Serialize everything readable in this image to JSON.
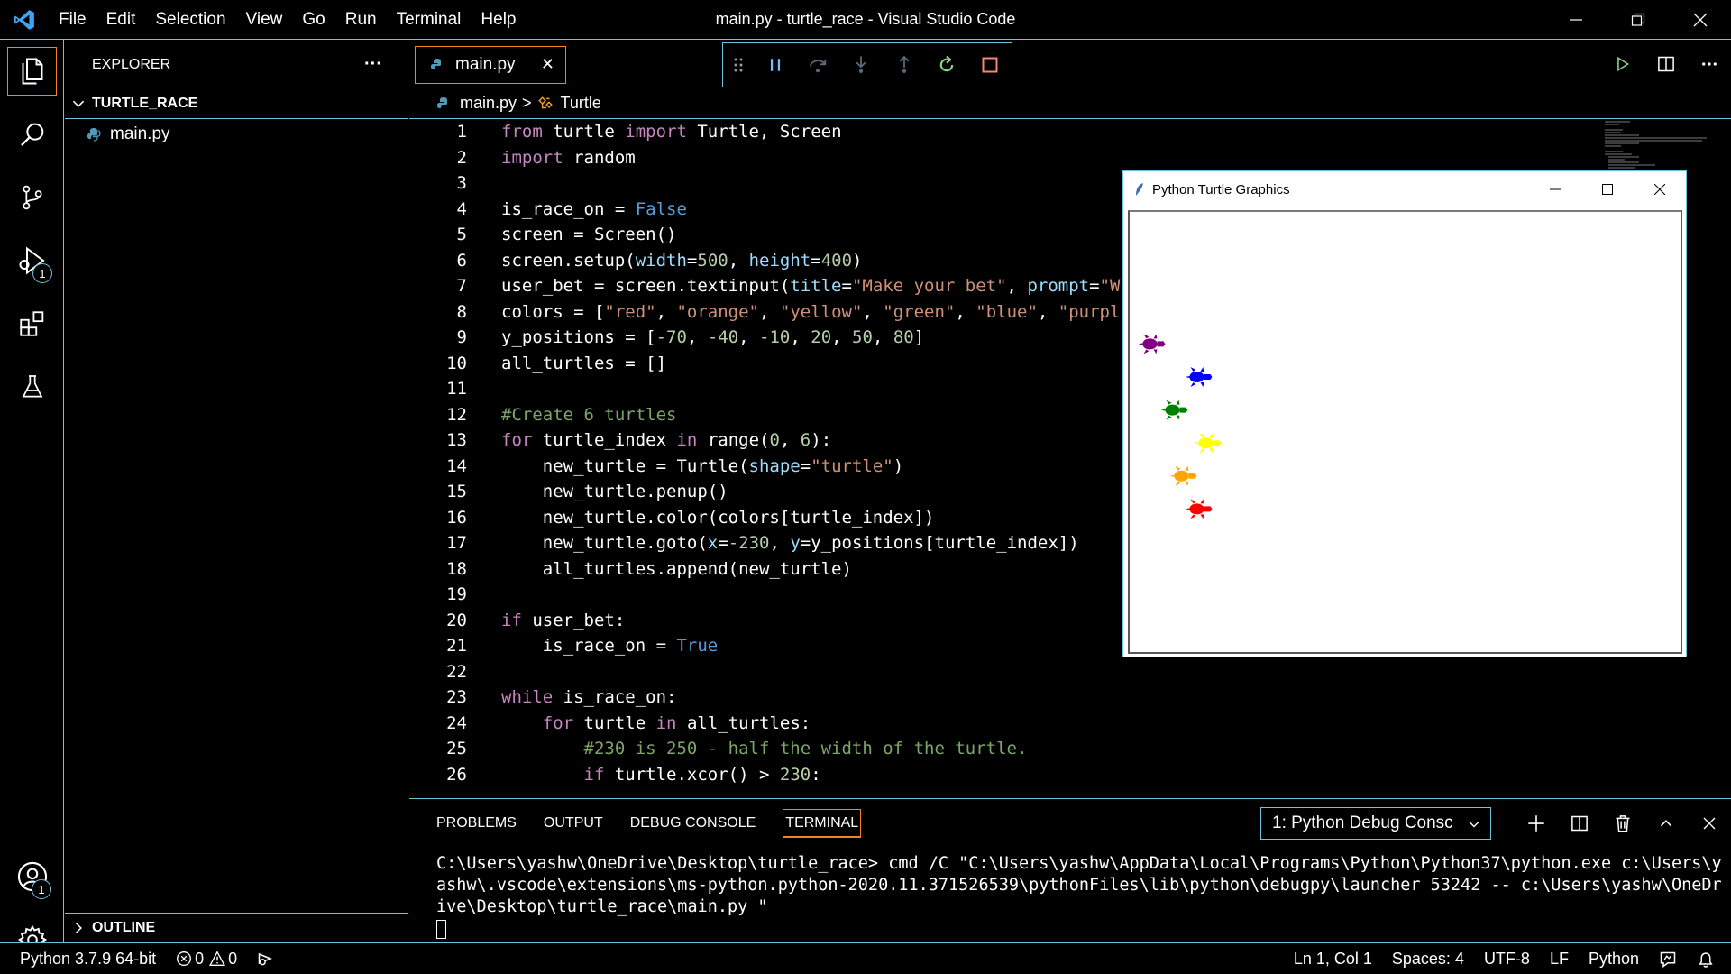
{
  "menu": [
    "File",
    "Edit",
    "Selection",
    "View",
    "Go",
    "Run",
    "Terminal",
    "Help"
  ],
  "window_title": "main.py - turtle_race - Visual Studio Code",
  "sidebar": {
    "header": "EXPLORER",
    "more": "···",
    "folder": "TURTLE_RACE",
    "file": "main.py",
    "outline": "OUTLINE"
  },
  "activity": {
    "debug_badge": "1",
    "account_badge": "1"
  },
  "tab": {
    "label": "main.py",
    "close": "✕"
  },
  "breadcrumb": {
    "file": "main.py",
    "sep": ">",
    "symbol": "Turtle"
  },
  "code_lines": [
    {
      "n": "1"
    },
    {
      "n": "2"
    },
    {
      "n": "3"
    },
    {
      "n": "4"
    },
    {
      "n": "5"
    },
    {
      "n": "6"
    },
    {
      "n": "7"
    },
    {
      "n": "8"
    },
    {
      "n": "9"
    },
    {
      "n": "10"
    },
    {
      "n": "11"
    },
    {
      "n": "12"
    },
    {
      "n": "13"
    },
    {
      "n": "14"
    },
    {
      "n": "15"
    },
    {
      "n": "16"
    },
    {
      "n": "17"
    },
    {
      "n": "18"
    },
    {
      "n": "19"
    },
    {
      "n": "20"
    },
    {
      "n": "21"
    },
    {
      "n": "22"
    },
    {
      "n": "23"
    },
    {
      "n": "24"
    },
    {
      "n": "25"
    },
    {
      "n": "26"
    }
  ],
  "turtle_window": {
    "title": "Python Turtle Graphics",
    "minimize": "—",
    "close": "✕",
    "turtles": [
      {
        "color": "#800080",
        "y": 80
      },
      {
        "color": "#0000ff",
        "y": 50
      },
      {
        "color": "#008000",
        "y": 20
      },
      {
        "color": "#ffff00",
        "y": -10
      },
      {
        "color": "#ffa500",
        "y": -40
      },
      {
        "color": "#ff0000",
        "y": -70
      }
    ]
  },
  "panel": {
    "tabs": [
      "PROBLEMS",
      "OUTPUT",
      "DEBUG CONSOLE",
      "TERMINAL"
    ],
    "active_tab": "TERMINAL",
    "terminal_select": "1: Python Debug Consc",
    "terminal_output": "C:\\Users\\yashw\\OneDrive\\Desktop\\turtle_race> cmd /C \"C:\\Users\\yashw\\AppData\\Local\\Programs\\Python\\Python37\\python.exe c:\\Users\\yashw\\.vscode\\extensions\\ms-python.python-2020.11.371526539\\pythonFiles\\lib\\python\\debugpy\\launcher 53242 -- c:\\Users\\yashw\\OneDrive\\Desktop\\turtle_race\\main.py \""
  },
  "statusbar": {
    "python": "Python 3.7.9 64-bit",
    "errors": "0",
    "warnings": "0",
    "position": "Ln 1, Col 1",
    "spaces": "Spaces: 4",
    "encoding": "UTF-8",
    "eol": "LF",
    "language": "Python"
  },
  "colors": {
    "border": "#6fc3df",
    "active_border": "#f38518",
    "debug_restart": "#89d185",
    "debug_stop": "#f48771",
    "debug_icon": "#75beff"
  }
}
